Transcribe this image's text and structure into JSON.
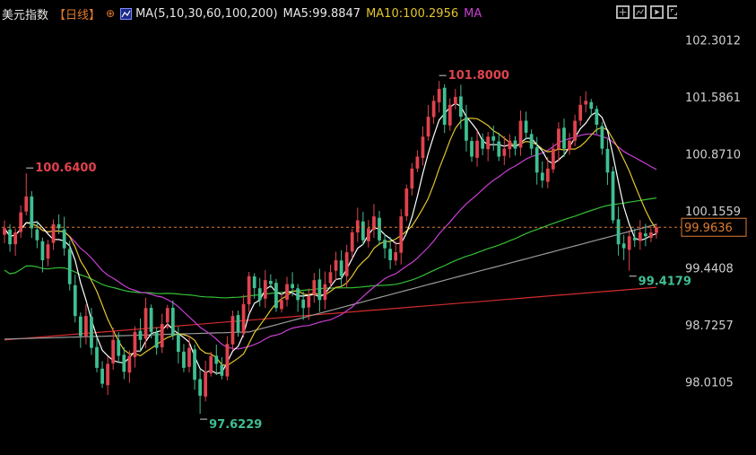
{
  "header": {
    "symbol": "美元指数",
    "period": "【日线】",
    "cross": "⊕",
    "ma_params": "MA(5,10,30,60,100,200)",
    "ma5": "MA5:99.8847",
    "ma10": "MA10:100.2956",
    "ma_more": "MA"
  },
  "toolbar": {
    "icons": [
      "grid-plus-icon",
      "chart-settings-icon",
      "play-icon",
      "expand-icon"
    ]
  },
  "colors": {
    "up": "#e0434e",
    "down": "#3fbf91",
    "ma5": "#ffffff",
    "ma10": "#e3c52e",
    "ma30": "#c93fd3",
    "ma60": "#34c034",
    "ma100": "#9a9a9a",
    "ma200": "#d22c2c",
    "current_line": "#e07a2e"
  },
  "chart_data": {
    "type": "candlestick",
    "ylim": [
      97.5,
      102.5
    ],
    "y_ticks": [
      "102.3012",
      "101.5861",
      "100.8710",
      "100.1559",
      "99.4408",
      "98.7257",
      "98.0105"
    ],
    "y_tick_values": [
      102.3012,
      101.5861,
      100.871,
      100.1559,
      99.4408,
      98.7257,
      98.0105
    ],
    "current_price": 99.9636,
    "current_price_label": "99.9636",
    "annotations": [
      {
        "text": "100.6400",
        "index": 4,
        "value": 100.64,
        "kind": "high"
      },
      {
        "text": "101.8000",
        "index": 80,
        "value": 101.8,
        "kind": "high"
      },
      {
        "text": "97.6229",
        "index": 36,
        "value": 97.6229,
        "kind": "low"
      },
      {
        "text": "99.4179",
        "index": 115,
        "value": 99.4179,
        "kind": "low"
      }
    ],
    "close": [
      99.95,
      99.75,
      99.9,
      100.15,
      100.35,
      99.95,
      99.8,
      99.55,
      99.75,
      100.0,
      99.95,
      99.7,
      99.25,
      98.85,
      98.6,
      98.85,
      98.45,
      98.2,
      98.0,
      98.25,
      98.55,
      98.35,
      98.15,
      98.35,
      98.65,
      98.55,
      98.95,
      98.65,
      98.45,
      98.75,
      98.95,
      98.6,
      98.4,
      98.2,
      98.45,
      98.05,
      97.85,
      98.15,
      98.35,
      98.25,
      98.1,
      98.5,
      98.85,
      98.65,
      99.0,
      99.35,
      99.2,
      99.05,
      99.3,
      99.25,
      98.95,
      99.05,
      99.25,
      99.2,
      99.05,
      98.95,
      99.1,
      99.3,
      99.05,
      99.25,
      99.4,
      99.55,
      99.35,
      99.65,
      99.9,
      100.05,
      99.8,
      99.95,
      100.1,
      99.8,
      99.7,
      99.55,
      99.65,
      100.1,
      100.45,
      100.7,
      100.85,
      101.1,
      101.35,
      101.55,
      101.7,
      101.25,
      101.5,
      101.6,
      101.35,
      101.05,
      100.85,
      101.05,
      100.95,
      101.1,
      101.05,
      100.85,
      100.95,
      101.05,
      100.95,
      101.3,
      101.15,
      100.95,
      100.65,
      100.55,
      100.7,
      100.95,
      101.2,
      100.95,
      101.05,
      101.3,
      101.5,
      101.55,
      101.45,
      101.25,
      100.95,
      100.65,
      100.05,
      99.75,
      99.7,
      99.85,
      99.8,
      99.9,
      99.85,
      99.9,
      99.9636
    ],
    "ma_series": [
      {
        "name": "MA5",
        "color_key": "ma5",
        "label": "MA5:99.8847"
      },
      {
        "name": "MA10",
        "color_key": "ma10",
        "label": "MA10:100.2956"
      },
      {
        "name": "MA30",
        "color_key": "ma30"
      },
      {
        "name": "MA60",
        "color_key": "ma60"
      },
      {
        "name": "MA100",
        "color_key": "ma100"
      },
      {
        "name": "MA200",
        "color_key": "ma200"
      }
    ]
  }
}
